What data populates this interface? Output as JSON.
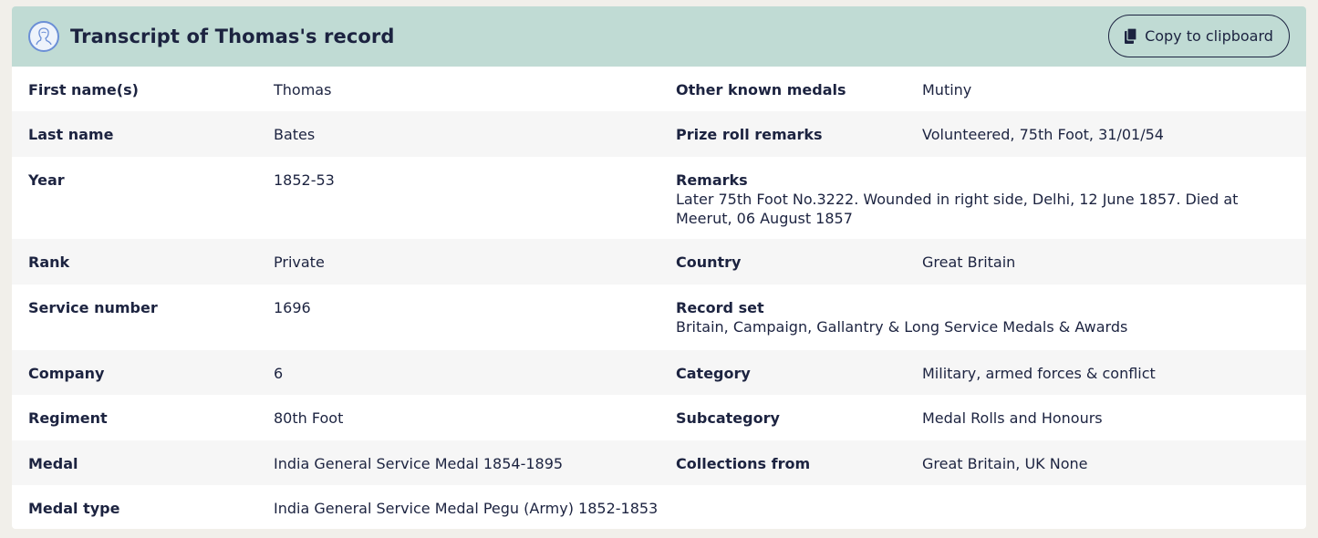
{
  "header": {
    "title": "Transcript of Thomas's record",
    "copy_label": "Copy to clipboard",
    "avatar_icon": "person-portrait-icon",
    "copy_icon": "clipboard-icon"
  },
  "rows": [
    {
      "l1": "First name(s)",
      "v1": "Thomas",
      "l2": "Other known medals",
      "v2": "Mutiny"
    },
    {
      "l1": "Last name",
      "v1": "Bates",
      "l2": "Prize roll remarks",
      "v2": "Volunteered, 75th Foot, 31/01/54"
    },
    {
      "l1": "Year",
      "v1": "1852-53",
      "l2": "Remarks",
      "v2": "Later 75th Foot No.3222. Wounded in right side, Delhi, 12 June 1857. Died at Meerut, 06 August 1857"
    },
    {
      "l1": "Rank",
      "v1": "Private",
      "l2": "Country",
      "v2": "Great Britain"
    },
    {
      "l1": "Service number",
      "v1": "1696",
      "l2": "Record set",
      "v2": "Britain, Campaign, Gallantry & Long Service Medals & Awards"
    },
    {
      "l1": "Company",
      "v1": "6",
      "l2": "Category",
      "v2": "Military, armed forces & conflict"
    },
    {
      "l1": "Regiment",
      "v1": "80th Foot",
      "l2": "Subcategory",
      "v2": "Medal Rolls and Honours"
    },
    {
      "l1": "Medal",
      "v1": "India General Service Medal 1854-1895",
      "l2": "Collections from",
      "v2": "Great Britain, UK None"
    },
    {
      "l1": "Medal type",
      "v1": "India General Service Medal Pegu (Army) 1852-1853",
      "l2": "",
      "v2": ""
    }
  ]
}
